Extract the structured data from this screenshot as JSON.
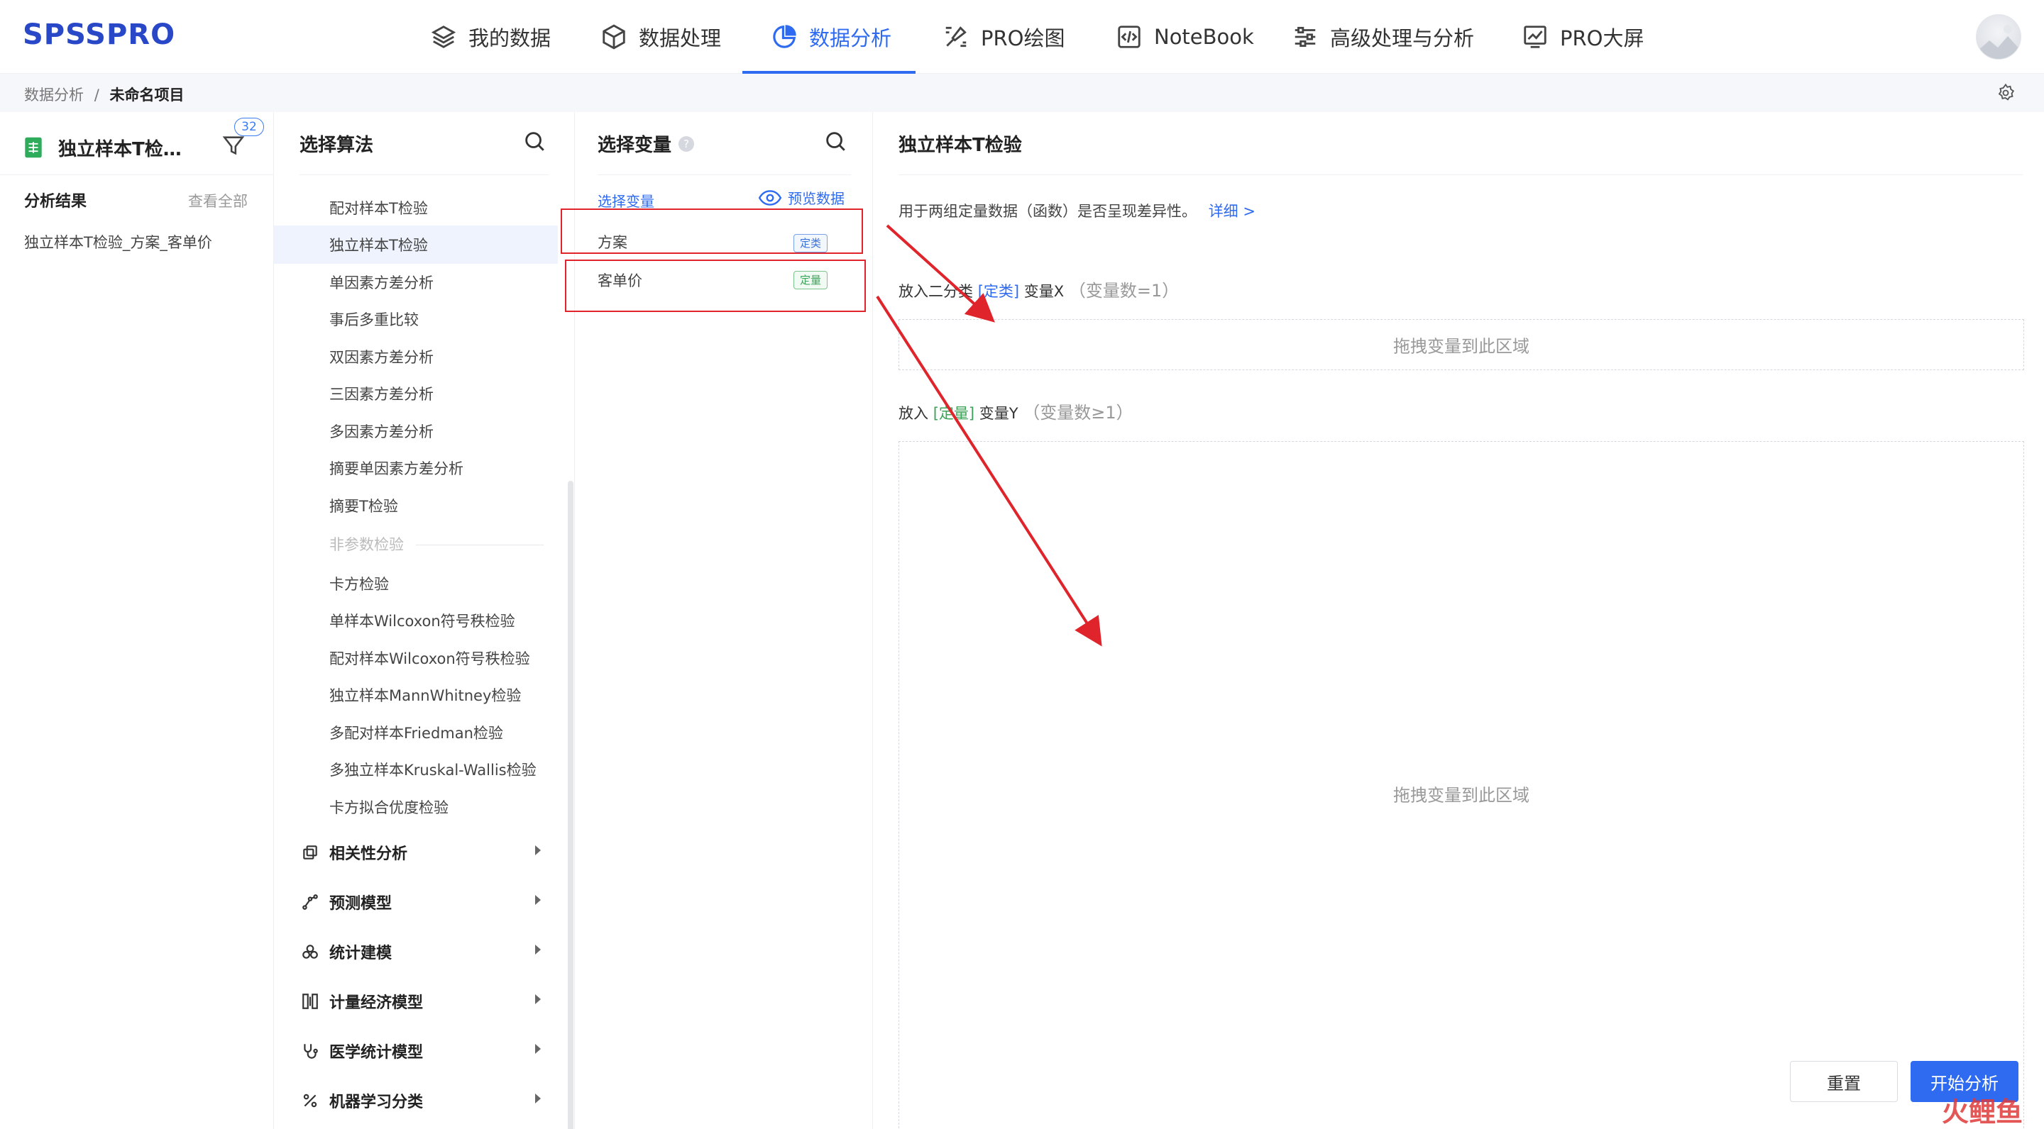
{
  "app": {
    "logo": "SPSSPRO"
  },
  "nav": {
    "items": [
      {
        "label": "我的数据",
        "icon": "layers-icon"
      },
      {
        "label": "数据处理",
        "icon": "cube-icon"
      },
      {
        "label": "数据分析",
        "icon": "pie-chart-icon"
      },
      {
        "label": "PRO绘图",
        "icon": "brush-icon"
      },
      {
        "label": "NoteBook",
        "icon": "code-icon"
      },
      {
        "label": "高级处理与分析",
        "icon": "sliders-icon"
      },
      {
        "label": "PRO大屏",
        "icon": "line-chart-icon"
      }
    ],
    "active": "数据分析"
  },
  "breadcrumb": {
    "parent": "数据分析",
    "sep": "/",
    "current": "未命名项目"
  },
  "project": {
    "name": "独立样本T检…",
    "filter_count": "32"
  },
  "results": {
    "heading": "分析结果",
    "view_all": "查看全部",
    "items": [
      "独立样本T检验_方案_客单价"
    ]
  },
  "algorithms": {
    "title": "选择算法",
    "items": [
      "配对样本T检验",
      "独立样本T检验",
      "单因素方差分析",
      "事后多重比较",
      "双因素方差分析",
      "三因素方差分析",
      "多因素方差分析",
      "摘要单因素方差分析",
      "摘要T检验"
    ],
    "selected": "独立样本T检验",
    "group_label": "非参数检验",
    "nonparam": [
      "卡方检验",
      "单样本Wilcoxon符号秩检验",
      "配对样本Wilcoxon符号秩检验",
      "独立样本MannWhitney检验",
      "多配对样本Friedman检验",
      "多独立样本Kruskal-Wallis检验",
      "卡方拟合优度检验"
    ],
    "categories": [
      "相关性分析",
      "预测模型",
      "统计建模",
      "计量经济模型",
      "医学统计模型",
      "机器学习分类"
    ]
  },
  "variables": {
    "title": "选择变量",
    "help": "?",
    "subheading": "选择变量",
    "preview": "预览数据",
    "items": [
      {
        "name": "方案",
        "tag": "定类"
      },
      {
        "name": "客单价",
        "tag": "定量"
      }
    ]
  },
  "main": {
    "title": "独立样本T检验",
    "desc": "用于两组定量数据（函数）是否呈现差异性。",
    "detail_link": "详细 >",
    "x_label": {
      "prefix": "放入二分类",
      "type": "[定类]",
      "var": "变量X",
      "count": "（变量数=1）"
    },
    "y_label": {
      "prefix": "放入",
      "type": "[定量]",
      "var": "变量Y",
      "count": "（变量数≥1）"
    },
    "drop_hint": "拖拽变量到此区域",
    "reset": "重置",
    "start": "开始分析"
  },
  "watermark": "火鲤鱼",
  "colors": {
    "accent": "#2f6bf0",
    "annotation": "#e0242b"
  }
}
